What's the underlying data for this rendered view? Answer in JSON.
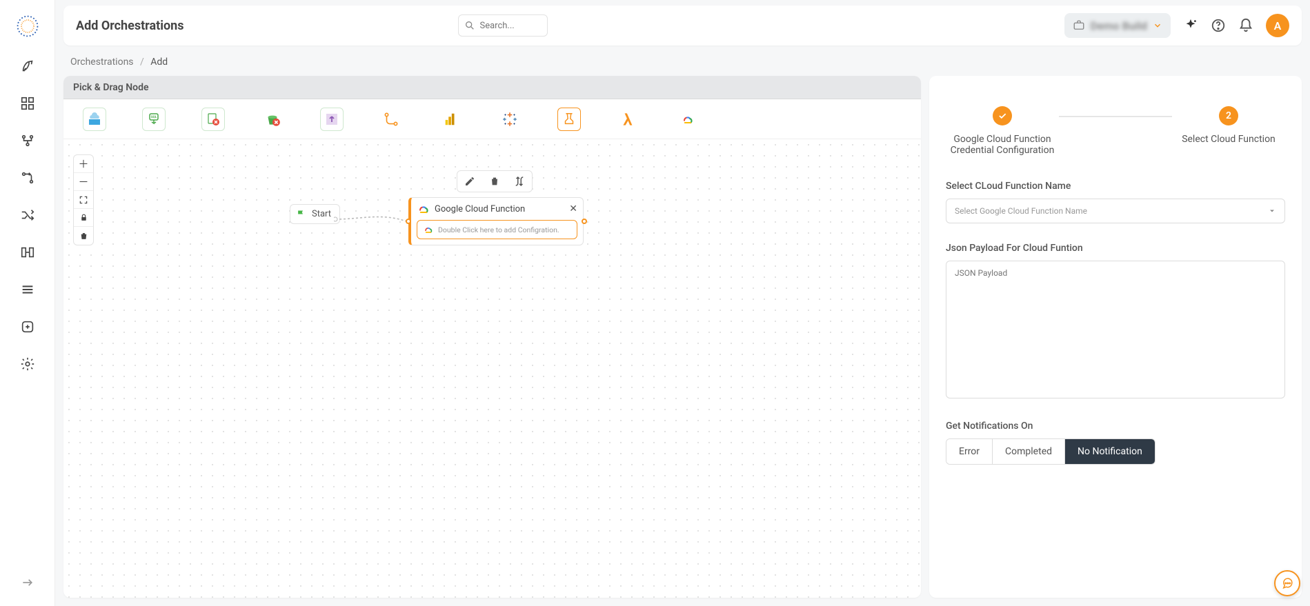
{
  "header": {
    "title": "Add Orchestrations",
    "search_placeholder": "Search...",
    "project_label": "Demo Build",
    "avatar_initial": "A"
  },
  "breadcrumb": {
    "root": "Orchestrations",
    "current": "Add"
  },
  "palette": {
    "title": "Pick & Drag Node"
  },
  "canvas": {
    "start_label": "Start",
    "gcf_node_title": "Google Cloud Function",
    "gcf_node_hint": "Double Click here to add Configration."
  },
  "panel": {
    "step1_label": "Google Cloud Function Credential Configuration",
    "step2_number": "2",
    "step2_label": "Select Cloud Function",
    "select_fn_label": "Select CLoud Function Name",
    "select_fn_placeholder": "Select Google Cloud Function Name",
    "json_label": "Json Payload For Cloud Funtion",
    "json_placeholder": "JSON Payload",
    "notif_label": "Get Notifications On",
    "notif_options": {
      "error": "Error",
      "completed": "Completed",
      "none": "No Notification"
    }
  }
}
